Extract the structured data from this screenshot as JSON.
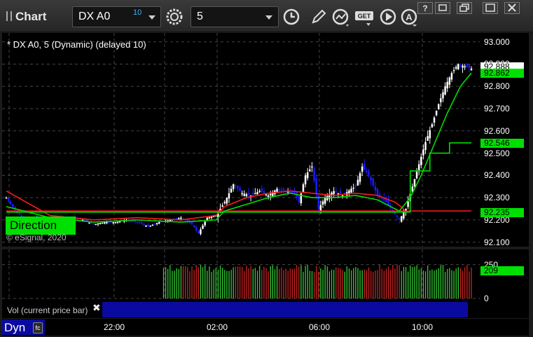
{
  "window": {
    "title": "Chart",
    "symbol": "DX A0",
    "symbol_delay": "10",
    "interval": "5"
  },
  "toolbar_icons": [
    "gear-icon",
    "clock-icon",
    "pencil-icon",
    "indicator-icon",
    "get-icon",
    "play-icon",
    "alert-icon"
  ],
  "study_label": "* DX A0, 5 (Dynamic) (delayed 10)",
  "copyright": "© eSignal, 2020",
  "direction_badge": "Direction",
  "volume_label": "Vol (current price bar)",
  "dyn_label": "Dyn",
  "fc_label": "fc",
  "colors": {
    "background": "#000000",
    "up_candle": "#ffffff",
    "down_candle": "#1a1aff",
    "ma_red": "#ff1a1a",
    "ma_green": "#00dd00",
    "vol_up": "#33cc33",
    "vol_down": "#cc2222",
    "tag_green": "#00e000"
  },
  "chart_data": {
    "type": "candlestick",
    "symbol": "DX A0",
    "interval": "5",
    "ylim": [
      92.08,
      93.04
    ],
    "y_ticks": [
      "93.000",
      "92.900",
      "92.800",
      "92.700",
      "92.600",
      "92.500",
      "92.400",
      "92.300",
      "92.200",
      "92.100"
    ],
    "x_ticks": [
      "22:00",
      "02:00",
      "06:00",
      "10:00"
    ],
    "price_tags": [
      {
        "label": "92.888",
        "value": 92.888,
        "color": "white"
      },
      {
        "label": "92.862",
        "value": 92.862,
        "color": "green"
      },
      {
        "label": "92.546",
        "value": 92.546,
        "color": "green"
      },
      {
        "label": "92.235",
        "value": 92.235,
        "color": "green"
      }
    ],
    "price_path": [
      [
        0,
        92.3
      ],
      [
        5,
        92.23
      ],
      [
        10,
        92.2
      ],
      [
        15,
        92.21
      ],
      [
        20,
        92.2
      ],
      [
        25,
        92.21
      ],
      [
        30,
        92.21
      ],
      [
        35,
        92.2
      ],
      [
        40,
        92.18
      ],
      [
        45,
        92.19
      ],
      [
        50,
        92.19
      ],
      [
        55,
        92.2
      ],
      [
        60,
        92.19
      ],
      [
        65,
        92.17
      ],
      [
        70,
        92.19
      ],
      [
        75,
        92.2
      ],
      [
        80,
        92.21
      ],
      [
        85,
        92.18
      ],
      [
        88,
        92.14
      ],
      [
        92,
        92.21
      ],
      [
        96,
        92.22
      ],
      [
        100,
        92.28
      ],
      [
        104,
        92.36
      ],
      [
        108,
        92.32
      ],
      [
        112,
        92.31
      ],
      [
        116,
        92.33
      ],
      [
        120,
        92.31
      ],
      [
        124,
        92.34
      ],
      [
        128,
        92.33
      ],
      [
        132,
        92.32
      ],
      [
        134,
        92.28
      ],
      [
        137,
        92.4
      ],
      [
        140,
        92.44
      ],
      [
        143,
        92.25
      ],
      [
        146,
        92.3
      ],
      [
        150,
        92.33
      ],
      [
        154,
        92.31
      ],
      [
        158,
        92.34
      ],
      [
        160,
        92.35
      ],
      [
        163,
        92.44
      ],
      [
        166,
        92.4
      ],
      [
        170,
        92.31
      ],
      [
        174,
        92.28
      ],
      [
        177,
        92.24
      ],
      [
        180,
        92.2
      ],
      [
        183,
        92.25
      ],
      [
        186,
        92.35
      ],
      [
        189,
        92.45
      ],
      [
        192,
        92.55
      ],
      [
        195,
        92.63
      ],
      [
        198,
        92.72
      ],
      [
        201,
        92.8
      ],
      [
        204,
        92.86
      ],
      [
        207,
        92.9
      ],
      [
        210,
        92.89
      ],
      [
        213,
        92.88
      ]
    ],
    "green_ma": [
      [
        0,
        92.26
      ],
      [
        20,
        92.21
      ],
      [
        40,
        92.19
      ],
      [
        60,
        92.2
      ],
      [
        80,
        92.19
      ],
      [
        96,
        92.2
      ],
      [
        100,
        92.24
      ],
      [
        110,
        92.27
      ],
      [
        120,
        92.3
      ],
      [
        130,
        92.32
      ],
      [
        140,
        92.3
      ],
      [
        150,
        92.3
      ],
      [
        160,
        92.31
      ],
      [
        170,
        92.29
      ],
      [
        180,
        92.24
      ],
      [
        185,
        92.3
      ],
      [
        190,
        92.4
      ],
      [
        196,
        92.54
      ],
      [
        202,
        92.68
      ],
      [
        208,
        92.8
      ],
      [
        213,
        92.86
      ]
    ],
    "red_ma": [
      [
        0,
        92.33
      ],
      [
        20,
        92.22
      ],
      [
        40,
        92.2
      ],
      [
        60,
        92.21
      ],
      [
        80,
        92.2
      ],
      [
        96,
        92.22
      ],
      [
        100,
        92.26
      ],
      [
        110,
        92.3
      ],
      [
        120,
        92.32
      ],
      [
        130,
        92.33
      ],
      [
        140,
        92.32
      ],
      [
        150,
        92.31
      ],
      [
        160,
        92.32
      ],
      [
        170,
        92.31
      ],
      [
        178,
        92.28
      ],
      [
        182,
        92.25
      ]
    ],
    "step_green": [
      [
        0,
        92.235
      ],
      [
        185,
        92.235
      ],
      [
        185,
        92.42
      ],
      [
        194,
        92.42
      ],
      [
        194,
        92.5
      ],
      [
        203,
        92.5
      ],
      [
        203,
        92.546
      ],
      [
        213,
        92.546
      ]
    ],
    "red_flat": {
      "value": 92.24,
      "x_start": 0,
      "x_end": 213
    },
    "volume": {
      "ticks": [
        "250",
        "0"
      ],
      "current_tag": "209",
      "ylim": [
        0,
        300
      ],
      "start_index": 72,
      "bars_count": 142
    }
  }
}
